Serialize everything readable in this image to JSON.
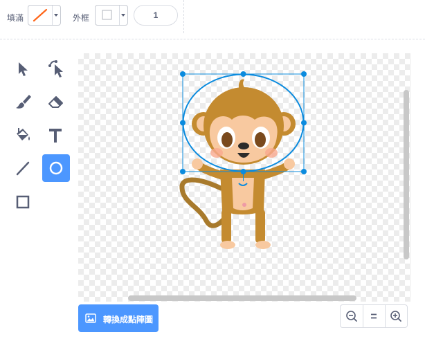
{
  "fill": {
    "label": "填滿",
    "swatch_icon": "no-fill-slash",
    "slash_color": "#ff661a"
  },
  "outline": {
    "label": "外框",
    "swatch_icon": "empty-square"
  },
  "outline_width": {
    "value": "1"
  },
  "tools": [
    {
      "name": "select",
      "icon": "arrow-pointer-icon",
      "active": false
    },
    {
      "name": "reshape",
      "icon": "reshape-pointer-icon",
      "active": false
    },
    {
      "name": "brush",
      "icon": "brush-icon",
      "active": false
    },
    {
      "name": "eraser",
      "icon": "eraser-icon",
      "active": false
    },
    {
      "name": "fill",
      "icon": "paint-bucket-icon",
      "active": false
    },
    {
      "name": "text",
      "icon": "text-icon",
      "active": false
    },
    {
      "name": "line",
      "icon": "line-icon",
      "active": false
    },
    {
      "name": "circle",
      "icon": "circle-icon",
      "active": true
    },
    {
      "name": "rectangle",
      "icon": "rectangle-icon",
      "active": false
    }
  ],
  "convert_button": {
    "label": "轉換成點陣圖",
    "icon": "bitmap-image-icon"
  },
  "zoom": {
    "zoom_out_icon": "zoom-out-icon",
    "reset_icon": "zoom-reset-icon",
    "zoom_in_icon": "zoom-in-icon"
  },
  "colors": {
    "accent": "#4c97ff",
    "selection": "#0b8bde",
    "ellipse_stroke": "#0b8bde",
    "fill_slash": "#ff661a"
  }
}
